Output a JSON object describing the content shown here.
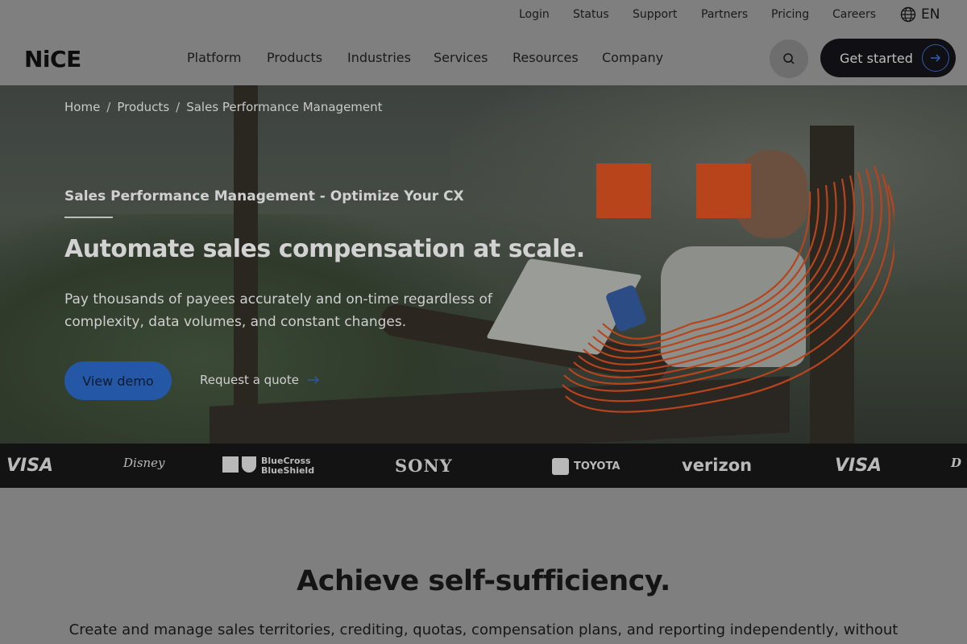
{
  "utility_nav": {
    "items": [
      "Login",
      "Status",
      "Support",
      "Partners",
      "Pricing",
      "Careers"
    ],
    "language": "EN"
  },
  "header": {
    "logo": "NiCE",
    "nav_items": [
      "Platform",
      "Products",
      "Industries",
      "Services",
      "Resources",
      "Company"
    ],
    "search_icon": "search-icon",
    "cta_label": "Get started"
  },
  "hero": {
    "breadcrumb": [
      "Home",
      "Products",
      "Sales Performance Management"
    ],
    "breadcrumb_separator": "/",
    "eyebrow": "Sales Performance Management - Optimize Your CX",
    "headline": "Automate sales compensation at scale.",
    "subtext": "Pay thousands of payees accurately and on-time regardless of complexity, data volumes, and constant changes.",
    "primary_cta": "View demo",
    "secondary_cta": "Request a quote",
    "accent_color": "#b8441c",
    "button_color": "#2458a6"
  },
  "logo_strip": {
    "brands": [
      "VISA",
      "Disney",
      "BlueCross BlueShield",
      "SONY",
      "TOYOTA",
      "verizon",
      "VISA",
      "D"
    ]
  },
  "section": {
    "title": "Achieve self-sufficiency.",
    "body": "Create and manage sales territories, crediting, quotas, compensation plans, and reporting independently, without"
  }
}
